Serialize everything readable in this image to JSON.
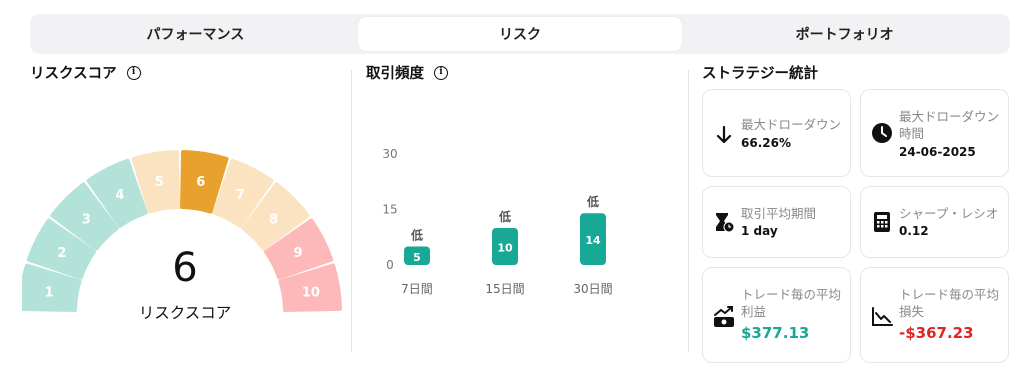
{
  "tabs": [
    {
      "label": "パフォーマンス"
    },
    {
      "label": "リスク"
    },
    {
      "label": "ポートフォリオ"
    }
  ],
  "risk_score": {
    "title": "リスクスコア",
    "value": "6",
    "label": "リスクスコア",
    "segments": [
      {
        "n": "1",
        "color": "#b3e2d9"
      },
      {
        "n": "2",
        "color": "#b3e2d9"
      },
      {
        "n": "3",
        "color": "#b3e2d9"
      },
      {
        "n": "4",
        "color": "#b3e2d9"
      },
      {
        "n": "5",
        "color": "#fbe3c2"
      },
      {
        "n": "6",
        "color": "#e8a12c"
      },
      {
        "n": "7",
        "color": "#fbe3c2"
      },
      {
        "n": "8",
        "color": "#fbe3c2"
      },
      {
        "n": "9",
        "color": "#fdb9b9"
      },
      {
        "n": "10",
        "color": "#fdb9b9"
      }
    ],
    "active": 6
  },
  "trade_frequency": {
    "title": "取引頻度",
    "chart_data": {
      "type": "bar",
      "categories": [
        "7日間",
        "15日間",
        "30日間"
      ],
      "values": [
        5,
        10,
        14
      ],
      "level_labels": [
        "低",
        "低",
        "低"
      ],
      "yticks": [
        "30",
        "15",
        "0"
      ],
      "ylim": [
        0,
        30
      ],
      "bar_color": "#17a896"
    }
  },
  "strategy": {
    "title": "ストラテジー統計",
    "cards": [
      {
        "label": "最大ドローダウン",
        "value": "66.26%",
        "icon": "arrow-down-icon"
      },
      {
        "label": "最大ドローダウン時間",
        "value": "24-06-2025",
        "icon": "clock-icon"
      },
      {
        "label": "取引平均期間",
        "value": "1 day",
        "icon": "hourglass-icon"
      },
      {
        "label": "シャープ・レシオ",
        "value": "0.12",
        "icon": "calculator-icon"
      },
      {
        "label": "トレード毎の平均利益",
        "value": "$377.13",
        "icon": "profit-chart-icon",
        "color": "#17a896"
      },
      {
        "label": "トレード毎の平均損失",
        "value": "-$367.23",
        "icon": "loss-chart-icon",
        "color": "#e02424"
      }
    ]
  }
}
